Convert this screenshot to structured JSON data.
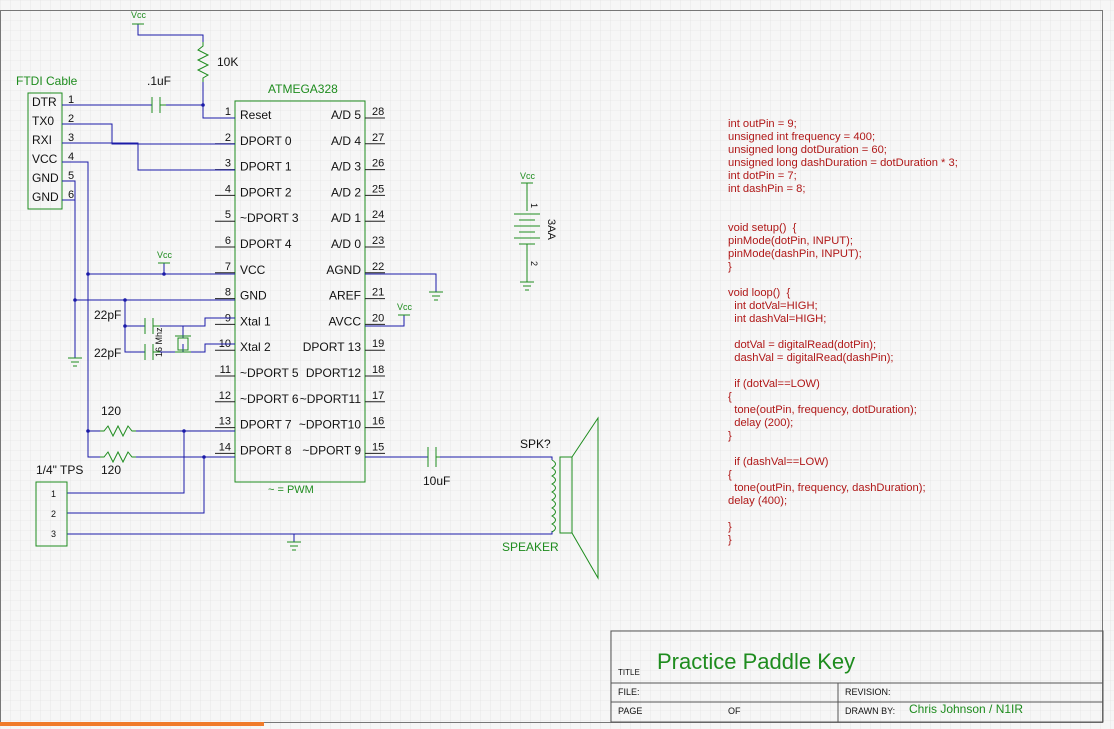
{
  "title_block": {
    "title_label": "TITLE",
    "title": "Practice Paddle Key",
    "file_label": "FILE:",
    "revision_label": "REVISION:",
    "page_label": "PAGE",
    "of_label": "OF",
    "drawn_by_label": "DRAWN BY:",
    "drawn_by": "Chris Johnson / N1IR"
  },
  "ftdi": {
    "title": "FTDI Cable",
    "pins": [
      {
        "name": "DTR",
        "num": "1"
      },
      {
        "name": "TX0",
        "num": "2"
      },
      {
        "name": "RXI",
        "num": "3"
      },
      {
        "name": "VCC",
        "num": "4"
      },
      {
        "name": "GND",
        "num": "5"
      },
      {
        "name": "GND",
        "num": "6"
      }
    ]
  },
  "mcu": {
    "name": "ATMEGA328",
    "footnote": "~ = PWM",
    "left_pins": [
      {
        "num": "1",
        "label": "Reset"
      },
      {
        "num": "2",
        "label": "DPORT 0"
      },
      {
        "num": "3",
        "label": "DPORT 1"
      },
      {
        "num": "4",
        "label": "DPORT 2"
      },
      {
        "num": "5",
        "label": "~DPORT 3"
      },
      {
        "num": "6",
        "label": "DPORT 4"
      },
      {
        "num": "7",
        "label": "VCC"
      },
      {
        "num": "8",
        "label": "GND"
      },
      {
        "num": "9",
        "label": "Xtal 1"
      },
      {
        "num": "10",
        "label": "Xtal 2"
      },
      {
        "num": "11",
        "label": "~DPORT 5"
      },
      {
        "num": "12",
        "label": "~DPORT 6"
      },
      {
        "num": "13",
        "label": "DPORT 7"
      },
      {
        "num": "14",
        "label": "DPORT 8"
      }
    ],
    "right_pins": [
      {
        "num": "28",
        "label": "A/D 5"
      },
      {
        "num": "27",
        "label": "A/D 4"
      },
      {
        "num": "26",
        "label": "A/D 3"
      },
      {
        "num": "25",
        "label": "A/D 2"
      },
      {
        "num": "24",
        "label": "A/D 1"
      },
      {
        "num": "23",
        "label": "A/D 0"
      },
      {
        "num": "22",
        "label": "AGND"
      },
      {
        "num": "21",
        "label": "AREF"
      },
      {
        "num": "20",
        "label": "AVCC"
      },
      {
        "num": "19",
        "label": "DPORT 13"
      },
      {
        "num": "18",
        "label": "DPORT12"
      },
      {
        "num": "17",
        "label": "~DPORT11"
      },
      {
        "num": "16",
        "label": "~DPORT10"
      },
      {
        "num": "15",
        "label": "~DPORT 9"
      }
    ]
  },
  "components": {
    "vcc_label": "Vcc",
    "r_reset": "10K",
    "c_reset": ".1uF",
    "c_xtal1": "22pF",
    "c_xtal2": "22pF",
    "crystal": "16 Mhz",
    "r1": "120",
    "r2": "120",
    "c_out": "10uF",
    "speaker_ref": "SPK?",
    "speaker": "SPEAKER",
    "jack": "1/4\" TPS",
    "jack_pins": [
      "1",
      "2",
      "3"
    ],
    "battery": "3AA",
    "battery_pins": [
      "1",
      "2"
    ]
  },
  "code_lines": [
    "int outPin = 9;",
    "unsigned int frequency = 400;",
    "unsigned long dotDuration = 60;",
    "unsigned long dashDuration = dotDuration * 3;",
    "int dotPin = 7;",
    "int dashPin = 8;",
    "",
    "",
    "void setup()  {",
    "pinMode(dotPin, INPUT);",
    "pinMode(dashPin, INPUT);",
    "}",
    "",
    "void loop()  {",
    "  int dotVal=HIGH;",
    "  int dashVal=HIGH;",
    "",
    "  dotVal = digitalRead(dotPin);",
    "  dashVal = digitalRead(dashPin);",
    "",
    "  if (dotVal==LOW)",
    "{",
    "  tone(outPin, frequency, dotDuration);",
    "  delay (200);",
    "}",
    "",
    "  if (dashVal==LOW)",
    "{",
    "  tone(outPin, frequency, dashDuration);",
    "delay (400);",
    "",
    "}",
    "}"
  ],
  "colors": {
    "wire": "#1a1aa8",
    "component": "#1e8c1e",
    "code": "#b01818",
    "grid": "#dcdcdc"
  }
}
